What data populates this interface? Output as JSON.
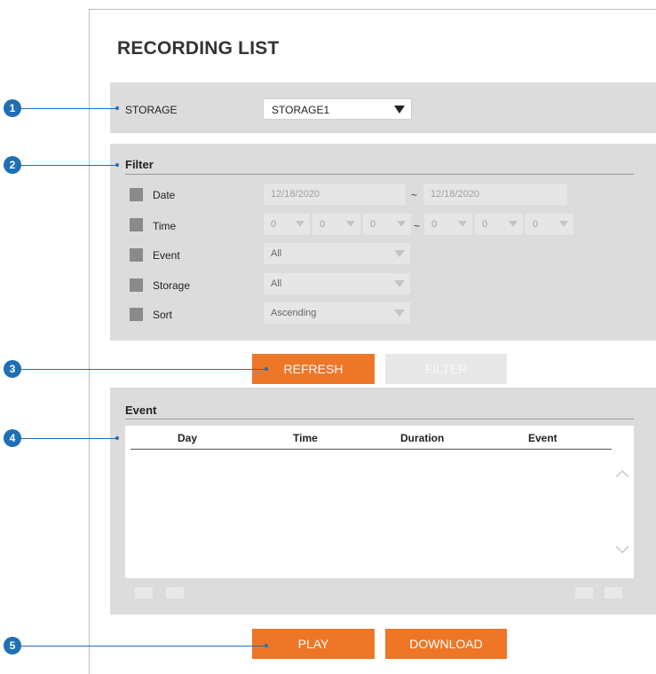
{
  "page": {
    "title": "RECORDING LIST"
  },
  "callouts": [
    "1",
    "2",
    "3",
    "4",
    "5"
  ],
  "storage": {
    "label": "STORAGE",
    "selected": "STORAGE1"
  },
  "filter": {
    "title": "Filter",
    "rows": {
      "date": {
        "label": "Date",
        "from": "12/18/2020",
        "tilde": "~",
        "to": "12/18/2020"
      },
      "time": {
        "label": "Time",
        "from": [
          "0",
          "0",
          "0"
        ],
        "tilde": "~",
        "to": [
          "0",
          "0",
          "0"
        ]
      },
      "event": {
        "label": "Event",
        "value": "All"
      },
      "storage": {
        "label": "Storage",
        "value": "All"
      },
      "sort": {
        "label": "Sort",
        "value": "Ascending"
      }
    }
  },
  "buttons": {
    "refresh": "REFRESH",
    "filter": "FILTER",
    "play": "PLAY",
    "download": "DOWNLOAD"
  },
  "event_panel": {
    "title": "Event",
    "columns": [
      "Day",
      "Time",
      "Duration",
      "Event"
    ]
  },
  "colors": {
    "accent": "#ed7627",
    "callout": "#1f6fb5",
    "panel": "#dcdcdc"
  }
}
